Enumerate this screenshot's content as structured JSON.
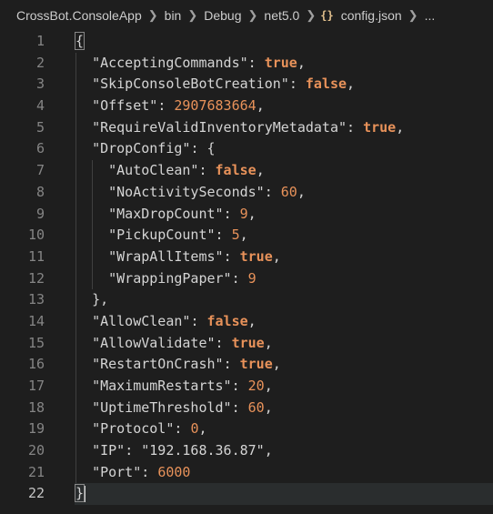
{
  "breadcrumb": {
    "items": [
      "CrossBot.ConsoleApp",
      "bin",
      "Debug",
      "net5.0"
    ],
    "file_icon": "{}",
    "file": "config.json",
    "more": "..."
  },
  "editor": {
    "current_line": 22,
    "lines": [
      {
        "n": "1"
      },
      {
        "n": "2",
        "key": "\"AcceptingCommands\"",
        "value": "true",
        "vtype": "bool",
        "trail": ","
      },
      {
        "n": "3",
        "key": "\"SkipConsoleBotCreation\"",
        "value": "false",
        "vtype": "bool",
        "trail": ","
      },
      {
        "n": "4",
        "key": "\"Offset\"",
        "value": "2907683664",
        "vtype": "num",
        "trail": ","
      },
      {
        "n": "5",
        "key": "\"RequireValidInventoryMetadata\"",
        "value": "true",
        "vtype": "bool",
        "trail": ","
      },
      {
        "n": "6",
        "key": "\"DropConfig\"",
        "value": "{",
        "vtype": "punc",
        "trail": ""
      },
      {
        "n": "7",
        "key": "\"AutoClean\"",
        "value": "false",
        "vtype": "bool",
        "trail": ","
      },
      {
        "n": "8",
        "key": "\"NoActivitySeconds\"",
        "value": "60",
        "vtype": "num",
        "trail": ","
      },
      {
        "n": "9",
        "key": "\"MaxDropCount\"",
        "value": "9",
        "vtype": "num",
        "trail": ","
      },
      {
        "n": "10",
        "key": "\"PickupCount\"",
        "value": "5",
        "vtype": "num",
        "trail": ","
      },
      {
        "n": "11",
        "key": "\"WrapAllItems\"",
        "value": "true",
        "vtype": "bool",
        "trail": ","
      },
      {
        "n": "12",
        "key": "\"WrappingPaper\"",
        "value": "9",
        "vtype": "num",
        "trail": ""
      },
      {
        "n": "13",
        "text": "},"
      },
      {
        "n": "14",
        "key": "\"AllowClean\"",
        "value": "false",
        "vtype": "bool",
        "trail": ","
      },
      {
        "n": "15",
        "key": "\"AllowValidate\"",
        "value": "true",
        "vtype": "bool",
        "trail": ","
      },
      {
        "n": "16",
        "key": "\"RestartOnCrash\"",
        "value": "true",
        "vtype": "bool",
        "trail": ","
      },
      {
        "n": "17",
        "key": "\"MaximumRestarts\"",
        "value": "20",
        "vtype": "num",
        "trail": ","
      },
      {
        "n": "18",
        "key": "\"UptimeThreshold\"",
        "value": "60",
        "vtype": "num",
        "trail": ","
      },
      {
        "n": "19",
        "key": "\"Protocol\"",
        "value": "0",
        "vtype": "num",
        "trail": ","
      },
      {
        "n": "20",
        "key": "\"IP\"",
        "value": "\"192.168.36.87\"",
        "vtype": "str",
        "trail": ","
      },
      {
        "n": "21",
        "key": "\"Port\"",
        "value": "6000",
        "vtype": "num",
        "trail": ""
      },
      {
        "n": "22"
      }
    ],
    "open_brace": "{",
    "close_brace": "}"
  }
}
